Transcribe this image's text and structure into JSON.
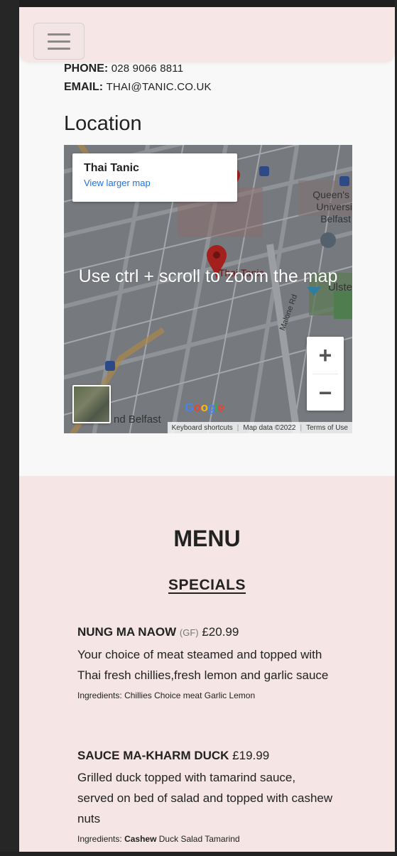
{
  "contact": {
    "phone_label": "PHONE:",
    "phone_value": "028 9066 8811",
    "email_label": "EMAIL:",
    "email_value": "THAI@TANIC.CO.UK"
  },
  "location": {
    "title": "Location",
    "map": {
      "card_name": "Thai Tanic",
      "card_link": "View larger map",
      "overlay_text": "Use ctrl + scroll to zoom the map",
      "zoom_in": "+",
      "zoom_out": "−",
      "logo": "Google",
      "attribution": [
        "Keyboard shortcuts",
        "Map data ©2022",
        "Terms of Use"
      ],
      "labels": {
        "queens": "Queen's",
        "university": "Universi",
        "belfast": "Belfast",
        "malone": "Malone Rd",
        "south_belfast": "nd Belfast",
        "ulster": "Ulste",
        "thai_tanic": "Thai Tanic"
      }
    }
  },
  "menu": {
    "title": "MENU",
    "specials_heading": "SPECIALS",
    "items": [
      {
        "name": "NUNG MA NAOW",
        "tag": "(GF)",
        "price": "£20.99",
        "description": "Your choice of meat steamed and topped with Thai fresh chillies,fresh lemon and garlic sauce",
        "ingredients_label": "Ingredients:",
        "ingredients": "Chillies Choice meat Garlic Lemon"
      },
      {
        "name": "SAUCE MA-KHARM DUCK",
        "price": "£19.99",
        "description": "Grilled duck topped with tamarind sauce, served on bed of salad and topped with cashew nuts",
        "ingredients_label": "Ingredients:",
        "ingredient_bold": "Cashew",
        "ingredients": "Duck Salad Tamarind"
      }
    ]
  },
  "colors": {
    "navbar_bg": "#f6e6e6",
    "menu_bg": "#f5e5e5",
    "link_blue": "#1a73e8",
    "map_pin": "#c5221f"
  }
}
